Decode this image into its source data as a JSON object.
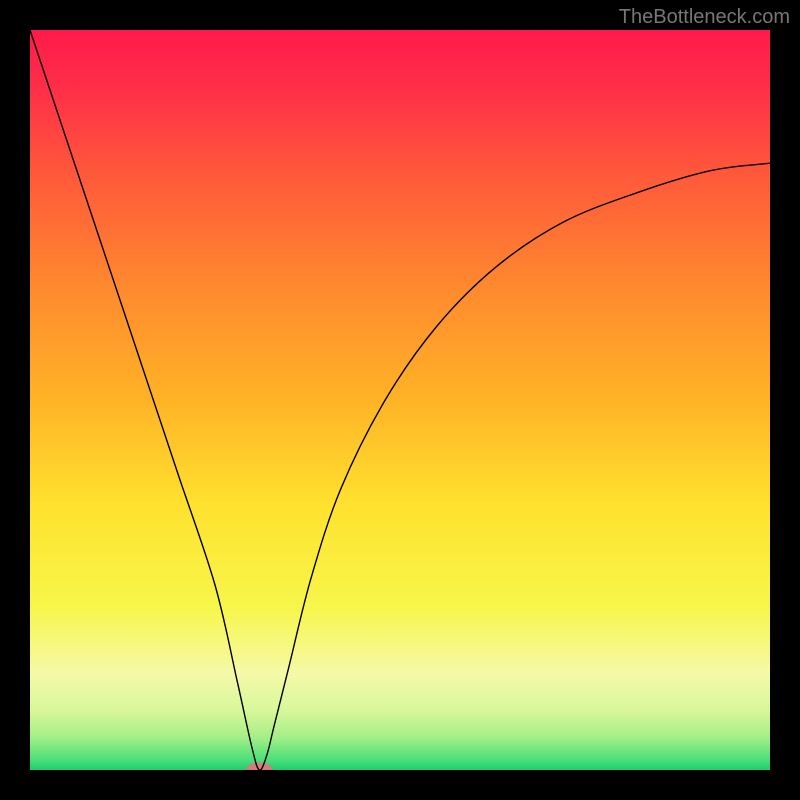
{
  "watermark": "TheBottleneck.com",
  "chart_data": {
    "type": "line",
    "title": "",
    "xlabel": "",
    "ylabel": "",
    "xlim": [
      0,
      100
    ],
    "ylim": [
      0,
      100
    ],
    "grid": false,
    "legend": false,
    "series": [
      {
        "name": "bottleneck-curve",
        "x": [
          0,
          5,
          10,
          15,
          20,
          25,
          28,
          30,
          31,
          32,
          33,
          35,
          38,
          42,
          48,
          55,
          63,
          72,
          82,
          92,
          100
        ],
        "y": [
          100,
          85,
          70,
          55,
          40,
          25,
          12,
          3,
          0,
          2,
          6,
          14,
          26,
          38,
          50,
          60,
          68,
          74,
          78,
          81,
          82
        ]
      }
    ],
    "minimum_marker": {
      "x": 31,
      "y": 0,
      "rx": 1.8,
      "ry": 1.0,
      "color": "#d77a7a"
    },
    "gradient_stops": [
      {
        "offset": 0.0,
        "color": "#ff1a4b"
      },
      {
        "offset": 0.08,
        "color": "#ff2f48"
      },
      {
        "offset": 0.2,
        "color": "#ff5a3a"
      },
      {
        "offset": 0.35,
        "color": "#ff8a2e"
      },
      {
        "offset": 0.5,
        "color": "#ffb326"
      },
      {
        "offset": 0.64,
        "color": "#ffe12e"
      },
      {
        "offset": 0.78,
        "color": "#f7f64a"
      },
      {
        "offset": 0.87,
        "color": "#f5f9a8"
      },
      {
        "offset": 0.92,
        "color": "#d7f79a"
      },
      {
        "offset": 0.955,
        "color": "#a6ef88"
      },
      {
        "offset": 0.985,
        "color": "#4fe07a"
      },
      {
        "offset": 1.0,
        "color": "#1dce6f"
      }
    ]
  }
}
